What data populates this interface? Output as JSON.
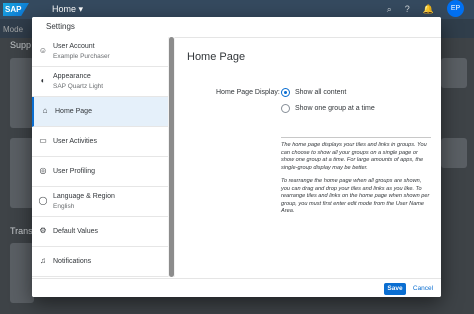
{
  "shell": {
    "logo": "SAP",
    "title": "Home",
    "avatar": "EP",
    "sub_label": "Mode",
    "bg_section_1": "Supp",
    "bg_section_2": "Trans"
  },
  "dialog": {
    "title": "Settings",
    "nav": [
      {
        "label": "User Account",
        "sub": "Example Purchaser",
        "icon": "user-icon"
      },
      {
        "label": "Appearance",
        "sub": "SAP Quartz Light",
        "icon": "palette-icon"
      },
      {
        "label": "Home Page",
        "sub": "",
        "icon": "home-icon"
      },
      {
        "label": "User Activities",
        "sub": "",
        "icon": "laptop-icon"
      },
      {
        "label": "User Profiling",
        "sub": "",
        "icon": "user-profile-icon"
      },
      {
        "label": "Language & Region",
        "sub": "English",
        "icon": "globe-icon"
      },
      {
        "label": "Default Values",
        "sub": "",
        "icon": "gear-icon"
      },
      {
        "label": "Notifications",
        "sub": "",
        "icon": "bell-icon"
      }
    ],
    "selected_nav": "Home Page",
    "content": {
      "title": "Home Page",
      "field_label": "Home Page Display:",
      "options": [
        {
          "label": "Show all content",
          "checked": true
        },
        {
          "label": "Show one group at a time",
          "checked": false
        }
      ],
      "desc_1": "The home page displays your tiles and links in groups. You can choose to show all your groups on a single page or show one group at a time. For large amounts of apps, the single-group display may be better.",
      "desc_2": "To rearrange the home page when all groups are shown, you can drag and drop your tiles and links as you like. To rearrange tiles and links on the home page when shown per group, you must first enter edit mode from the User Name Area."
    },
    "save_label": "Save",
    "cancel_label": "Cancel"
  },
  "colors": {
    "accent": "#0a6ed1",
    "shell": "#354a5f",
    "selected_bg": "#e5f0fa"
  }
}
